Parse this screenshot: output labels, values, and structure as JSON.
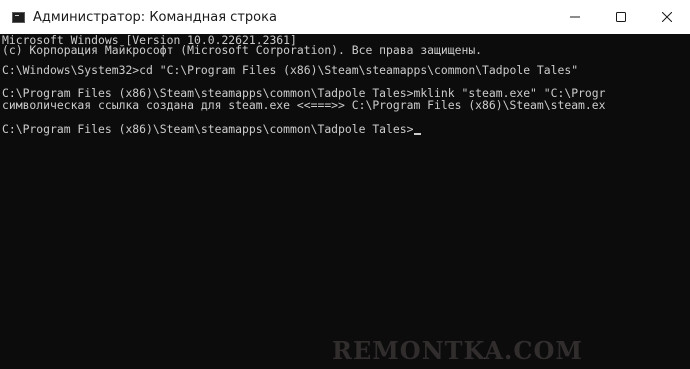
{
  "window": {
    "title": "Администратор: Командная строка",
    "icon": "terminal-icon",
    "controls": {
      "minimize_icon": "minimize-icon",
      "maximize_icon": "maximize-icon",
      "close_icon": "close-icon"
    }
  },
  "console": {
    "lines": [
      "Microsoft Windows [Version 10.0.22621.2361]",
      "(c) Корпорация Майкрософт (Microsoft Corporation). Все права защищены.",
      "",
      "C:\\Windows\\System32>cd \"C:\\Program Files (x86)\\Steam\\steamapps\\common\\Tadpole Tales\"",
      "",
      "C:\\Program Files (x86)\\Steam\\steamapps\\common\\Tadpole Tales>mklink \"steam.exe\" \"C:\\Progr",
      "символическая ссылка создана для steam.exe <<===>> C:\\Program Files (x86)\\Steam\\steam.ex",
      "",
      "C:\\Program Files (x86)\\Steam\\steamapps\\common\\Tadpole Tales>"
    ]
  },
  "watermark": "REMONTKA.COM",
  "colors": {
    "console_bg": "#0c0c0c",
    "console_fg": "#cccccc",
    "titlebar_bg": "#ffffff"
  }
}
